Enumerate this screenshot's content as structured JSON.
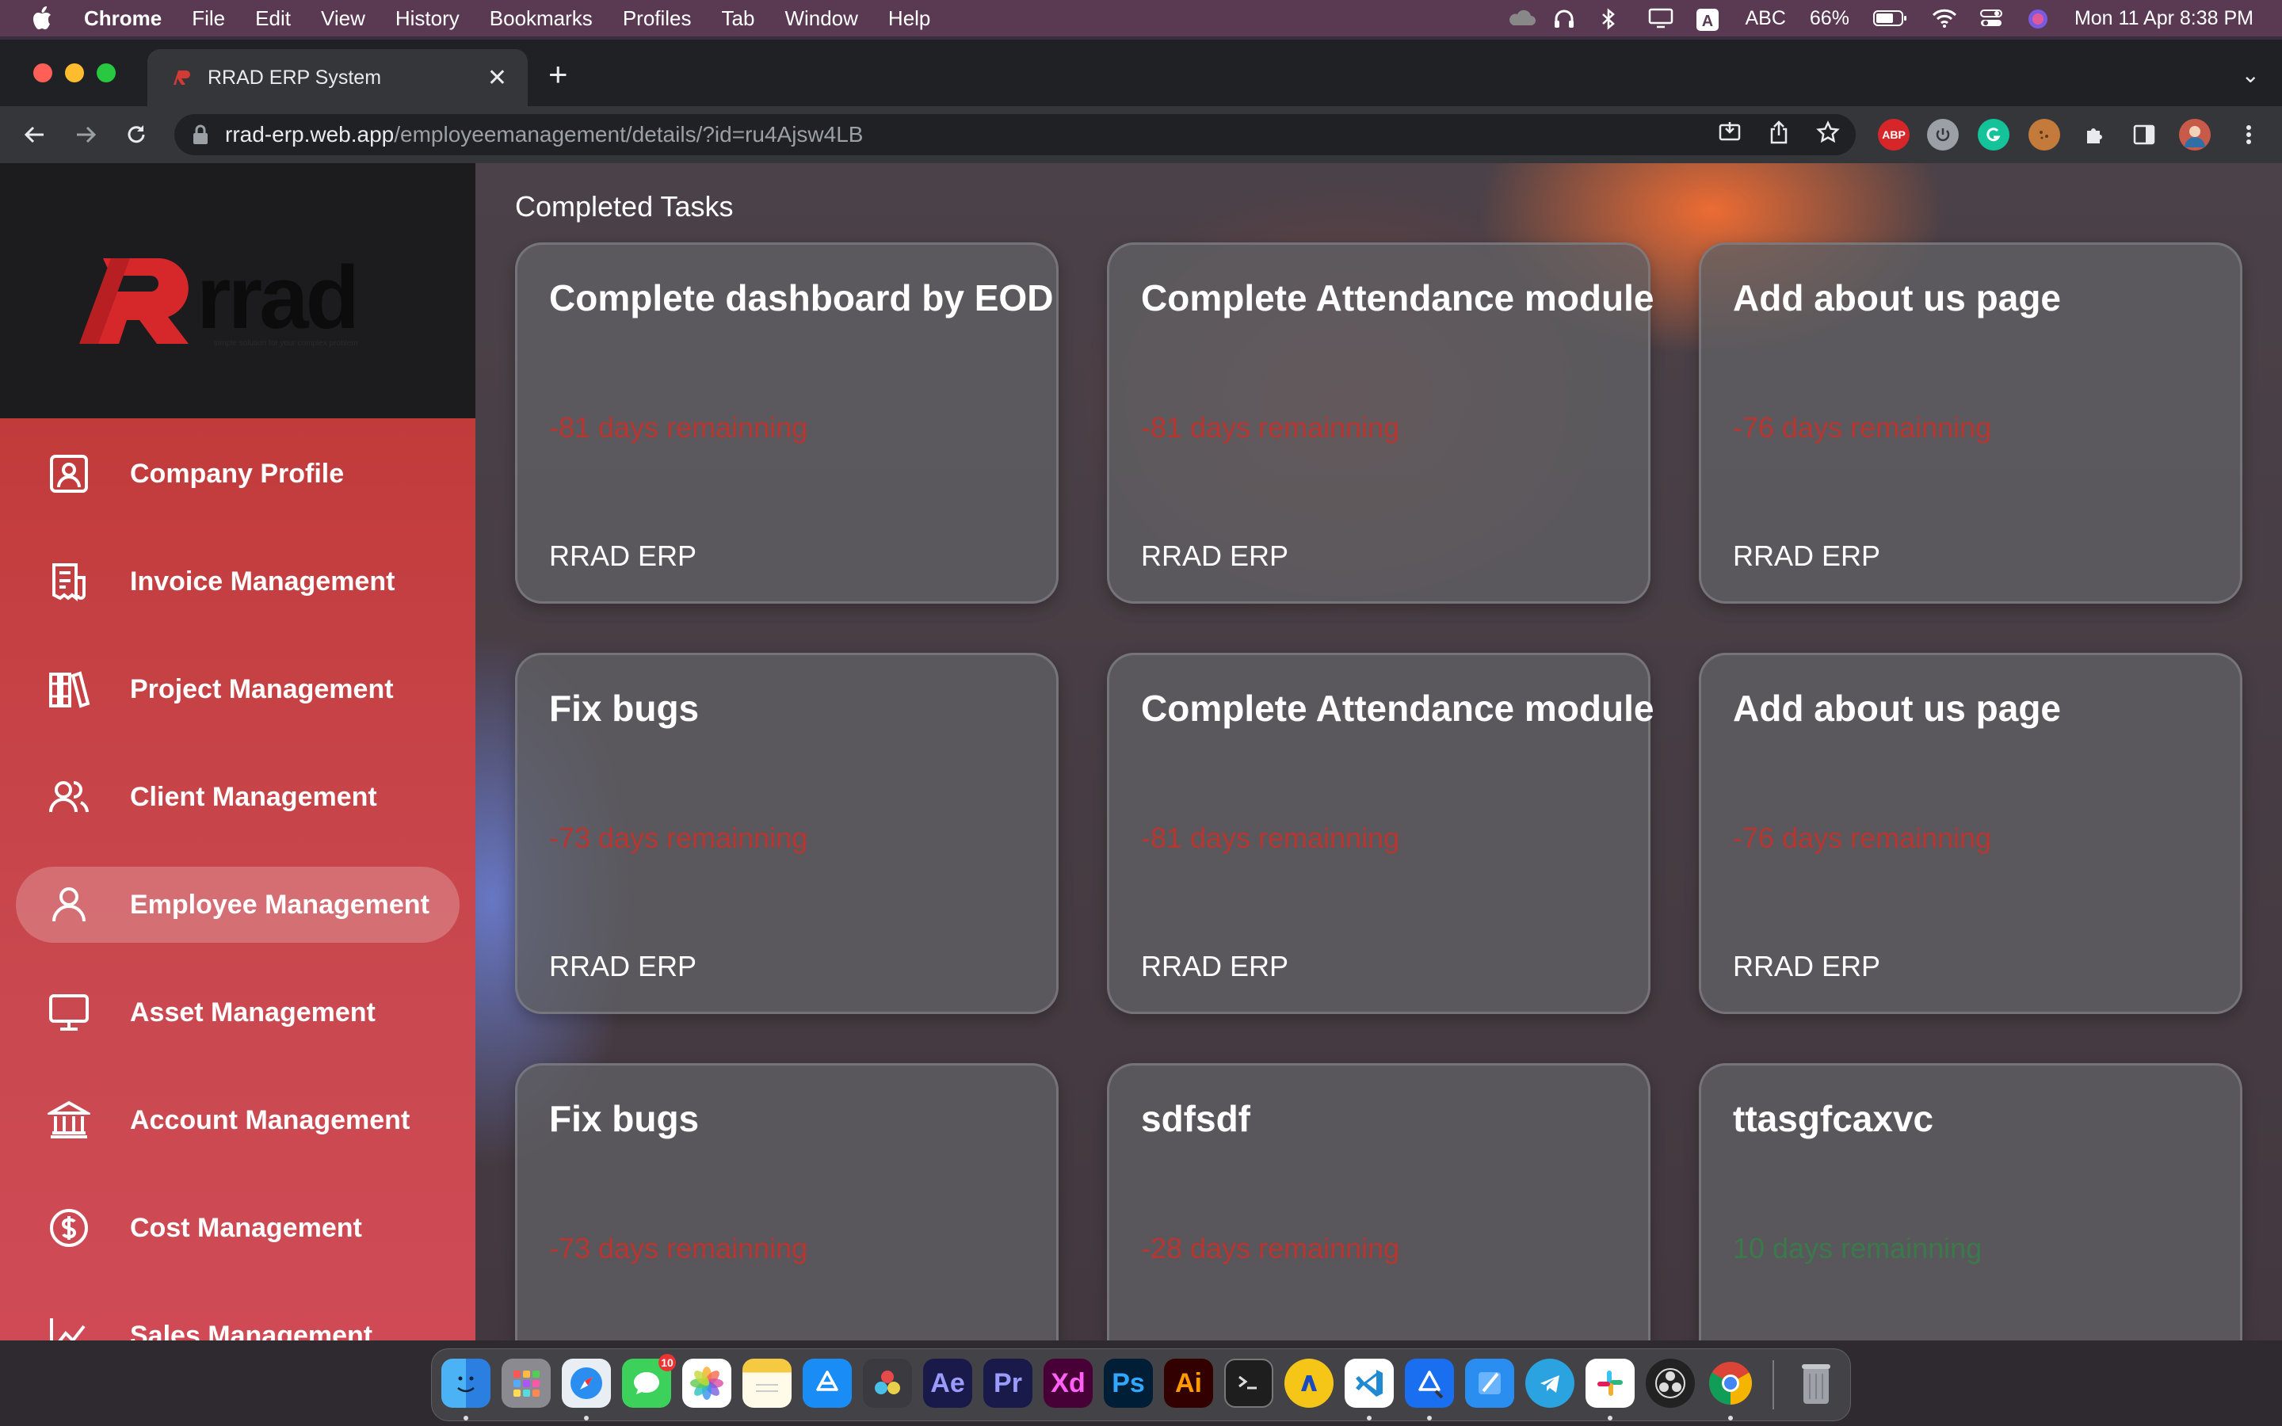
{
  "menubar": {
    "app_name": "Chrome",
    "items": [
      "File",
      "Edit",
      "View",
      "History",
      "Bookmarks",
      "Profiles",
      "Tab",
      "Window",
      "Help"
    ],
    "input_source": "ABC",
    "battery": "66%",
    "datetime": "Mon 11 Apr  8:38 PM"
  },
  "browser": {
    "tab_title": "RRAD ERP System",
    "url_host": "rrad-erp.web.app",
    "url_path": "/employeemanagement/details/?id=ru4Ajsw4LB",
    "extensions": {
      "abp_label": "ABP"
    }
  },
  "logo": {
    "wordmark": "rrad",
    "tagline": "simple solution for your complex problem"
  },
  "sidebar": {
    "items": [
      {
        "label": "Company Profile",
        "icon": "profile-card-icon",
        "active": false
      },
      {
        "label": "Invoice Management",
        "icon": "invoice-icon",
        "active": false
      },
      {
        "label": "Project Management",
        "icon": "books-icon",
        "active": false
      },
      {
        "label": "Client Management",
        "icon": "users-icon",
        "active": false
      },
      {
        "label": "Employee Management",
        "icon": "user-icon",
        "active": true
      },
      {
        "label": "Asset Management",
        "icon": "monitor-icon",
        "active": false
      },
      {
        "label": "Account Management",
        "icon": "bank-icon",
        "active": false
      },
      {
        "label": "Cost Management",
        "icon": "dollar-circle-icon",
        "active": false
      },
      {
        "label": "Sales Management",
        "icon": "chart-line-icon",
        "active": false
      }
    ]
  },
  "main": {
    "section_title": "Completed Tasks",
    "tasks": [
      {
        "title": "Complete dashboard by EOD",
        "days": "-81 days remainning",
        "project": "RRAD ERP",
        "overdue": true
      },
      {
        "title": "Complete Attendance module",
        "days": "-81 days remainning",
        "project": "RRAD ERP",
        "overdue": true
      },
      {
        "title": "Add about us page",
        "days": "-76 days remainning",
        "project": "RRAD ERP",
        "overdue": true
      },
      {
        "title": "Fix bugs",
        "days": "-73 days remainning",
        "project": "RRAD ERP",
        "overdue": true
      },
      {
        "title": "Complete Attendance module",
        "days": "-81 days remainning",
        "project": "RRAD ERP",
        "overdue": true
      },
      {
        "title": "Add about us page",
        "days": "-76 days remainning",
        "project": "RRAD ERP",
        "overdue": true
      },
      {
        "title": "Fix bugs",
        "days": "-73 days remainning",
        "project": "",
        "overdue": true
      },
      {
        "title": "sdfsdf",
        "days": "-28 days remainning",
        "project": "",
        "overdue": true
      },
      {
        "title": "ttasgfcaxvc",
        "days": "10 days remainning",
        "project": "",
        "overdue": false
      }
    ]
  },
  "dock": {
    "messages_badge": "10",
    "labels": {
      "ae": "Ae",
      "pr": "Pr",
      "xd": "Xd",
      "ps": "Ps",
      "ai": "Ai"
    }
  },
  "colors": {
    "accent": "#c23b3b",
    "overdue": "#b83530",
    "upcoming": "#3a7a4a"
  }
}
